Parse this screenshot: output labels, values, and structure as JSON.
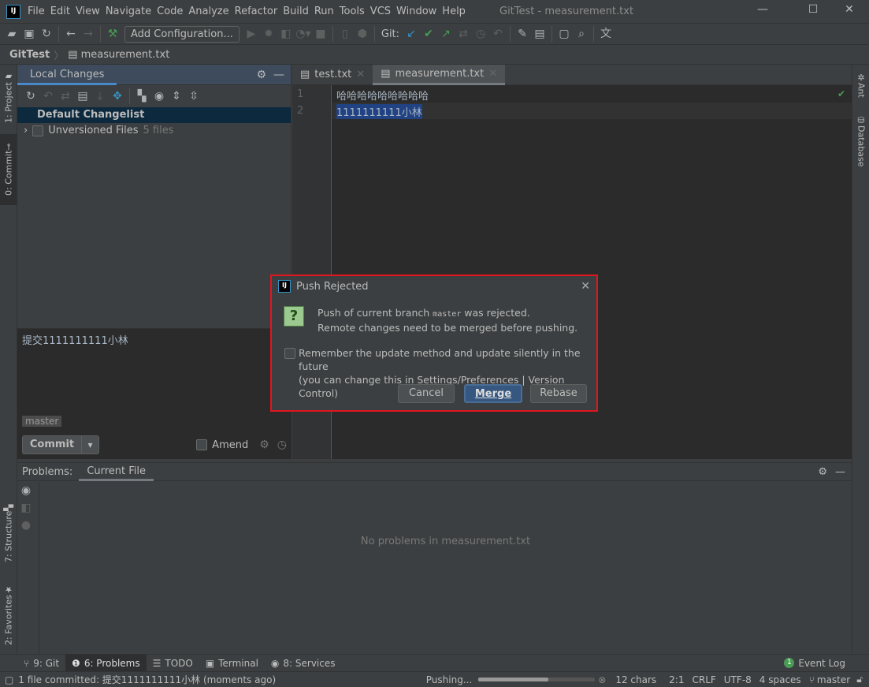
{
  "menubar": {
    "items": [
      "File",
      "Edit",
      "View",
      "Navigate",
      "Code",
      "Analyze",
      "Refactor",
      "Build",
      "Run",
      "Tools",
      "VCS",
      "Window",
      "Help"
    ],
    "title": "GitTest - measurement.txt",
    "logo": "IJ"
  },
  "toolbar": {
    "add_configuration": "Add Configuration...",
    "git_label": "Git:"
  },
  "breadcrumb": {
    "project": "GitTest",
    "file": "measurement.txt"
  },
  "left_stripe": {
    "project": "1: Project",
    "commit": "0: Commit",
    "structure": "7: Structure",
    "favorites": "2: Favorites"
  },
  "right_stripe": {
    "ant": "Ant",
    "database": "Database"
  },
  "commit_panel": {
    "tab": "Local Changes",
    "changelist": "Default Changelist",
    "unversioned": "Unversioned Files",
    "unversioned_count": "5 files",
    "message": "提交1111111111小林",
    "branch": "master",
    "commit_button": "Commit",
    "amend_label": "Amend"
  },
  "editor": {
    "tabs": [
      {
        "label": "test.txt"
      },
      {
        "label": "measurement.txt",
        "active": true
      }
    ],
    "lines": [
      {
        "num": "1",
        "text": "哈哈哈哈哈哈哈哈哈"
      },
      {
        "num": "2",
        "text": "1111111111小林"
      }
    ]
  },
  "problems": {
    "label": "Problems:",
    "tab": "Current File",
    "empty": "No problems in measurement.txt"
  },
  "bottom_tabs": {
    "git": "9: Git",
    "problems": "6: Problems",
    "todo": "TODO",
    "terminal": "Terminal",
    "services": "8: Services",
    "event_log": "Event Log",
    "event_count": "1"
  },
  "status": {
    "message": "1 file committed: 提交1111111111小林 (moments ago)",
    "pushing": "Pushing...",
    "progress": 0.6,
    "chars": "12 chars",
    "position": "2:1",
    "line_sep": "CRLF",
    "encoding": "UTF-8",
    "indent": "4 spaces",
    "branch": "master"
  },
  "dialog": {
    "title": "Push Rejected",
    "line1_pre": "Push of current branch",
    "branch": "master",
    "line1_post": "was rejected.",
    "line2": "Remote changes need to be merged before pushing.",
    "remember": "Remember the update method and update silently in the future",
    "remember_hint": "(you can change this in Settings/Preferences | Version Control)",
    "cancel": "Cancel",
    "merge": "Merge",
    "rebase": "Rebase"
  },
  "colors": {
    "accent": "#4a88c7",
    "selection": "#214283",
    "dialog_border": "#e0161e",
    "merge_button": "#365880"
  }
}
